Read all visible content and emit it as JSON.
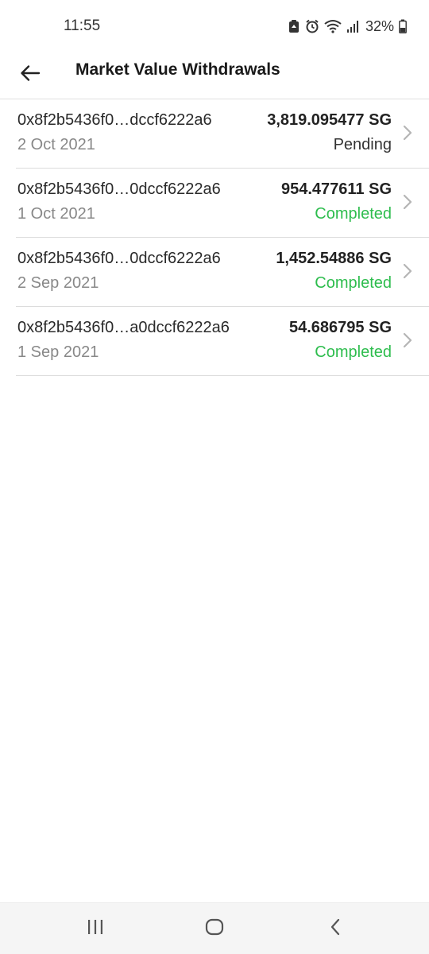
{
  "status_bar": {
    "time": "11:55",
    "battery": "32%"
  },
  "header": {
    "title": "Market Value Withdrawals"
  },
  "withdrawals": [
    {
      "tx_id": "0x8f2b5436f0…dccf6222a6",
      "date": "2 Oct 2021",
      "amount": "3,819.095477 SG",
      "status": "Pending"
    },
    {
      "tx_id": "0x8f2b5436f0…0dccf6222a6",
      "date": "1 Oct 2021",
      "amount": "954.477611 SG",
      "status": "Completed"
    },
    {
      "tx_id": "0x8f2b5436f0…0dccf6222a6",
      "date": "2 Sep 2021",
      "amount": "1,452.54886 SG",
      "status": "Completed"
    },
    {
      "tx_id": "0x8f2b5436f0…a0dccf6222a6",
      "date": "1 Sep 2021",
      "amount": "54.686795 SG",
      "status": "Completed"
    }
  ],
  "colors": {
    "completed": "#2ebd4e",
    "pending": "#333333"
  },
  "icons": {
    "back": "arrow-left-icon",
    "chevron": "chevron-right-icon",
    "nav_recents": "recents-icon",
    "nav_home": "home-icon",
    "nav_back": "nav-back-icon"
  }
}
